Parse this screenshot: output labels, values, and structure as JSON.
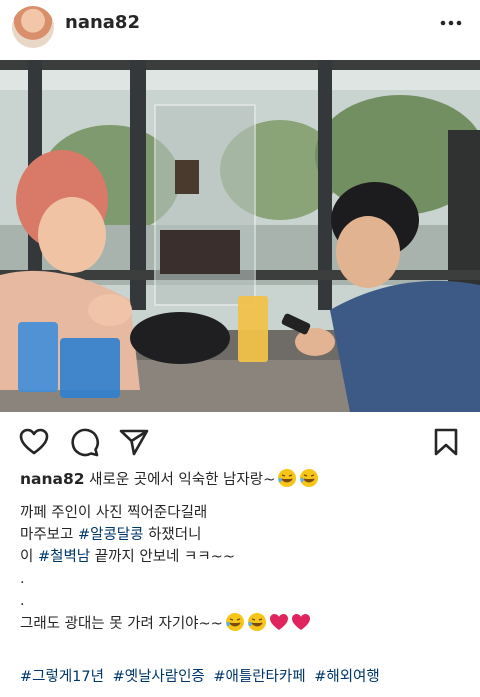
{
  "post": {
    "username": "nana82",
    "icons": {
      "more": "more-options-icon",
      "like": "heart-outline-icon",
      "comment": "comment-bubble-icon",
      "share": "paper-plane-icon",
      "save": "bookmark-icon"
    }
  },
  "caption": {
    "username": "nana82",
    "first_line": "새로운 곳에서 익숙한 남자랑~",
    "line2": "까페 주인이 사진 찍어준다길래",
    "line3_pre": "마주보고 ",
    "line3_tag": "#알콩달콩",
    "line3_post": " 하쟀더니",
    "line4_pre": "이 ",
    "line4_tag": "#철벽남",
    "line4_post": " 끝까지 안보네 ㅋㅋ~~",
    "dot1": ".",
    "dot2": ".",
    "line7": "그래도 광대는 못 가려 자기야~~"
  },
  "hashtags": [
    "#그렇게17년",
    "#옛날사람인증",
    "#애틀란타카페",
    "#해외여행"
  ],
  "colors": {
    "text": "#262626",
    "link": "#00376b",
    "heart": "#e0245e",
    "emoji": "#f5c518"
  }
}
